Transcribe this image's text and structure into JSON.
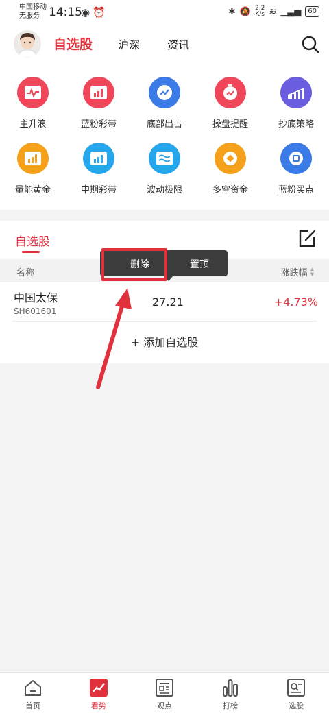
{
  "status_bar": {
    "carrier_line1": "中国移动",
    "carrier_line2": "无服务",
    "time": "14:15",
    "speed_top": "2.2",
    "speed_bottom": "K/s",
    "battery": "60"
  },
  "header": {
    "tabs": [
      "自选股",
      "沪深",
      "资讯"
    ],
    "active_tab": "自选股",
    "avatar_icon": "avatar-icon",
    "search_icon": "search-icon"
  },
  "features": [
    {
      "label": "主升浪",
      "icon": "pulse-icon",
      "color": "#f0465a"
    },
    {
      "label": "蓝粉彩带",
      "icon": "ribbon-chart-icon",
      "color": "#f0465a"
    },
    {
      "label": "底部出击",
      "icon": "trend-up-icon",
      "color": "#3a7be8"
    },
    {
      "label": "操盘提醒",
      "icon": "alarm-icon",
      "color": "#f0465a"
    },
    {
      "label": "抄底策略",
      "icon": "strategy-chart-icon",
      "color": "#6b5de0"
    },
    {
      "label": "量能黄金",
      "icon": "volume-chart-icon",
      "color": "#f5a11c"
    },
    {
      "label": "中期彩带",
      "icon": "mid-ribbon-icon",
      "color": "#28a6ec"
    },
    {
      "label": "波动极限",
      "icon": "wave-icon",
      "color": "#28a6ec"
    },
    {
      "label": "多空资金",
      "icon": "coin-icon",
      "color": "#f5a11c"
    },
    {
      "label": "蓝粉买点",
      "icon": "buy-point-icon",
      "color": "#3a7be8"
    }
  ],
  "watchlist": {
    "title": "自选股",
    "edit_icon": "edit-icon",
    "col_name": "名称",
    "col_change": "涨跌幅",
    "rows": [
      {
        "name": "中国太保",
        "code": "SH601601",
        "price": "27.21",
        "change": "+4.73%"
      }
    ],
    "add_label": "+ 添加自选股"
  },
  "popup": {
    "delete_label": "删除",
    "pin_label": "置顶"
  },
  "bottom_nav": [
    {
      "label": "首页",
      "icon": "home-icon"
    },
    {
      "label": "看势",
      "icon": "trend-icon"
    },
    {
      "label": "观点",
      "icon": "news-icon"
    },
    {
      "label": "打榜",
      "icon": "bar-chart-icon"
    },
    {
      "label": "选股",
      "icon": "stock-pick-icon"
    }
  ],
  "colors": {
    "accent": "#e0313d"
  }
}
